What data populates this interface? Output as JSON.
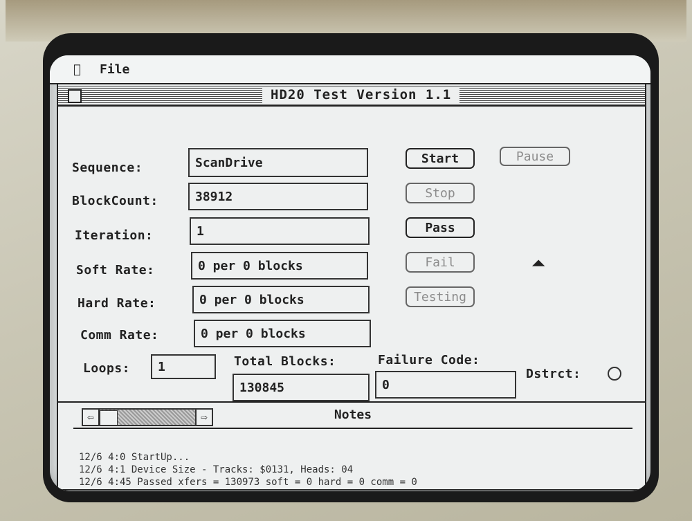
{
  "menubar": {
    "apple_icon": "apple-logo-icon",
    "file_label": "File"
  },
  "window": {
    "title": "HD20 Test Version 1.1"
  },
  "labels": {
    "sequence": "Sequence:",
    "block_count": "BlockCount:",
    "iteration": "Iteration:",
    "soft_rate": "Soft Rate:",
    "hard_rate": "Hard Rate:",
    "comm_rate": "Comm Rate:",
    "loops": "Loops:",
    "total_blocks": "Total Blocks:",
    "failure_code": "Failure Code:",
    "dstrct": "Dstrct:"
  },
  "values": {
    "sequence": "ScanDrive",
    "block_count": "38912",
    "iteration": "1",
    "soft_rate": "0 per 0 blocks",
    "hard_rate": "0 per 0 blocks",
    "comm_rate": "0 per 0 blocks",
    "loops": "1",
    "total_blocks": "130845",
    "failure_code": "0"
  },
  "buttons": {
    "start": "Start",
    "pause": "Pause",
    "stop": "Stop",
    "pass": "Pass",
    "fail": "Fail",
    "testing": "Testing"
  },
  "notes": {
    "title": "Notes",
    "lines": [
      "12/6 4:0 StartUp...",
      "12/6 4:1 Device Size - Tracks: $0131, Heads: 04",
      "12/6 4:45 Passed xfers = 130973 soft = 0 hard = 0 comm = 0"
    ]
  }
}
